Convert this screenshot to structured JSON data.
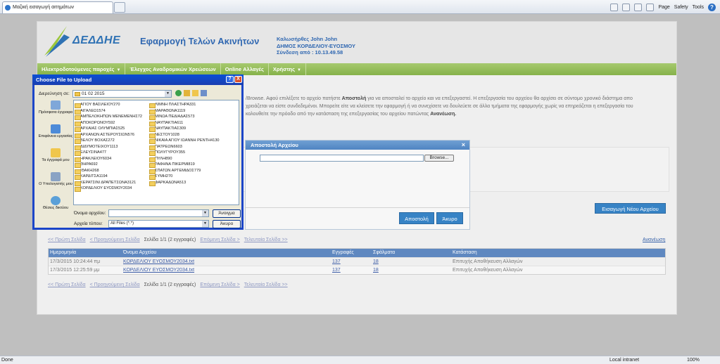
{
  "browser": {
    "tab_title": "Μαζική εισαγωγή αιτημάτων",
    "commands": [
      "Page",
      "Safety",
      "Tools"
    ],
    "status": "Done",
    "zone": "Local intranet",
    "zoom": "100%"
  },
  "header": {
    "logo_text": "ΔΕΔΔΗΕ",
    "app_title": "Εφαρμογή Τελών Ακινήτων",
    "welcome_line1": "Καλωσήρθες John John",
    "welcome_line2": "ΔΗΜΟΣ ΚΟΡΔΕΛΙΟΥ-ΕΥΟΣΜΟΥ",
    "welcome_line3": "Σύνδεση από : 10.13.49.58"
  },
  "menu": [
    {
      "label": "Ηλεκτροδοτούμενες παροχές",
      "caret": "▼"
    },
    {
      "label": "Έλεγχος Αναδρομικών Χρεώσεων",
      "caret": ""
    },
    {
      "label": "Online Αλλαγές",
      "caret": ""
    },
    {
      "label": "Χρήστης",
      "caret": "▼"
    }
  ],
  "intro": {
    "p1": "/Browse. Αφού επιλέξετε το αρχείο πατήστε",
    "b1": "Αποστολή",
    "p2": "για να αποσταλεί το αρχείο και να επεξεργαστεί. Η επεξεργασία του αρχείου θα αρχίσει σε σύντομο χρονικό διάστημα απο",
    "p3": "χρειάζεται να είστε συνδεδεμένοι. Μπορείτε είτε να κλείσετε την εφαρμογή ή να συνεχίσετε να δουλεύετε σε άλλα τμήματα της εφαρμογής χωρίς να επηρεάζεται η επεξεργασία του",
    "p4": "κολουθείτε την πρόοδο από την κατάσταση της επεξεργασίας του αρχείου πατώντας",
    "b2": "Ανανέωση."
  },
  "upload_button": "Εισαγωγή Νέου Αρχείου",
  "pager": {
    "first": "<< Πρώτη Σελίδα",
    "prev": "< Προηγούμενη Σελίδα",
    "current": "Σελίδα 1/1 (2 εγγραφές)",
    "next": "Επόμενη Σελίδα >",
    "last": "Τελευταία Σελίδα >>",
    "refresh": "Ανανέωση"
  },
  "table": {
    "headers": [
      "Ημερομηνία",
      "Όνομα Αρχείου",
      "Εγγραφές",
      "Σφάλματα",
      "Κατάσταση"
    ],
    "rows": [
      [
        "17/3/2015 10:24:44 πμ",
        "ΚΟΡΔΕΛΙΟΥ ΕΥΟΣΜΟΥ2034.txt",
        "137",
        "18",
        "Επιτυχής Αποθήκευση Αλλαγών"
      ],
      [
        "17/3/2015 12:25:59 μμ",
        "ΚΟΡΔΕΛΙΟΥ ΕΥΟΣΜΟΥ2034.txt",
        "137",
        "18",
        "Επιτυχής Αποθήκευση Αλλαγών"
      ]
    ]
  },
  "modal": {
    "title": "Αποστολή Αρχείου",
    "browse": "Browse...",
    "send": "Αποστολή",
    "cancel": "Άκυρο",
    "close": "×"
  },
  "dialog": {
    "title": "Choose File to Upload",
    "help": "?",
    "close": "X",
    "lookin_label": "Διερεύνηση σε:",
    "lookin_value": "01 02 2015",
    "places": [
      "Πρόσφατα έγγραφα",
      "Επιφάνεια εργασίας",
      "Τα έγγραφά μου",
      "Ο Υπολογιστής μου",
      "Θέσεις δικτύου"
    ],
    "files_col1": [
      "ΑΓΙΟΥ ΒΑΣΙΛΕΙΟΥ270",
      "ΑΙΓΑΛΕΩ1574",
      "ΑΜΠΕΛΟΚΗΠΩΝ ΜΕΝΕΜΕΝΗΣ72",
      "ΑΠΟΚΟΡΩΝΟΥ592",
      "ΑΡΧΑΙΑΣ ΟΛΥΜΠΙΑΣ525",
      "ΑΡΧΑΝΩΝ ΑΣΤΕΡΟΥΣΙΩΝ576",
      "ΒΕΛΟΥ ΒΟΧΑΣ272",
      "ΔΙΔΥΜΟΤΕΙΧΟΥ1113",
      "ΕΛΕΥΣΙΝΑ477",
      "ΗΡΑΚΛΕΙΟΥ6034",
      "ΘΗΡΑ692",
      "ΙΘΑΚΗ268",
      "ΚΑΡΔΙΤΣΑ1194",
      "ΚΕΡΑΤΣΙΝΙ ΔΡΑΠΕΤΣΩΝΑ3121",
      "ΚΟΡΔΕΛΙΟΥ ΕΥΟΣΜΟΥ2034"
    ],
    "files_col2": [
      "ΛΙΜΝΗ ΠΛΑΣΤΗΡΑ331",
      "ΜΑΡΑΘΩΝΑ1119",
      "ΜΙΝΩΑ ΠΕΔΙΑΔΑΣ573",
      "ΝΑΥΠΑΚΤΙΑ611",
      "ΝΑΥΠΑΚΤΙΑΣ309",
      "ΝΕΣΤΟΥ1028",
      "ΝΙΚΑΙΑ ΑΓΙΟΥ ΙΩΑΝΝΗ ΡΕΝΤΗ4130",
      "ΠΑΤΡΕΩΝ6603",
      "ΠΟΛΥΓΥΡΟΥ355",
      "ΠΥΛΗ890",
      "ΡΑΦΗΝΑ ΠΙΚΕΡΜΙ819",
      "ΣΠΑΤΩΝ ΑΡΤΕΜΙΔΟΣ779",
      "ΣΥΜΗ270",
      "ΦΑΡΚΑΔΩΝΑ513"
    ],
    "filename_label": "Όνομα αρχείου:",
    "filetype_label": "Αρχεία τύπου:",
    "filename_value": "",
    "filetype_value": "All Files (*.*)",
    "open": "Άνοιγμα",
    "cancel": "Άκυρο"
  },
  "colors": {
    "menu_green": "#8ab551",
    "brand_blue": "#2f72b4",
    "button_blue": "#3783c5",
    "grid_header": "#5f88c0",
    "dialog_frame": "#1c46c8"
  }
}
